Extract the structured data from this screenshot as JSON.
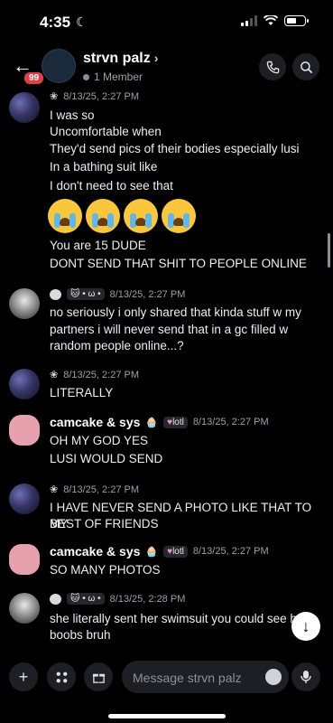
{
  "status_bar": {
    "time": "4:35"
  },
  "header": {
    "back_badge": "99",
    "channel_name": "strvn palz",
    "members": "1 Member"
  },
  "messages": [
    {
      "author": "",
      "timestamp": "8/13/25, 2:27 PM",
      "lines": [
        "I was so",
        "Uncomfortable when",
        "They'd send pics of their bodies especially lusi",
        "In a bathing suit like",
        "I don't need to see that"
      ],
      "emojis": [
        "loudly-crying-face",
        "loudly-crying-face",
        "loudly-crying-face",
        "loudly-crying-face"
      ],
      "after_lines": [
        "You are 15 DUDE",
        "DONT SEND THAT SHIT TO PEOPLE ONLINE"
      ]
    },
    {
      "author": "",
      "tag": "• ω •",
      "timestamp": "8/13/25, 2:27 PM",
      "lines": [
        "no seriously i only shared that kinda stuff w my",
        "partners i will never send that in a gc filled w",
        "random people online...?"
      ]
    },
    {
      "author": "",
      "timestamp": "8/13/25, 2:27 PM",
      "lines": [
        "LITERALLY"
      ]
    },
    {
      "author": "camcake & sys",
      "tag": "lotl",
      "timestamp": "8/13/25, 2:27 PM",
      "lines": [
        "OH MY GOD YES",
        "LUSI WOULD SEND"
      ]
    },
    {
      "author": "",
      "timestamp": "8/13/25, 2:27 PM",
      "lines": [
        "I HAVE NEVER SEND A PHOTO LIKE THAT TO MY",
        "BEST OF FRIENDS"
      ]
    },
    {
      "author": "camcake & sys",
      "tag": "lotl",
      "timestamp": "8/13/25, 2:27 PM",
      "lines": [
        "SO MANY PHOTOS"
      ]
    },
    {
      "author": "",
      "tag": "• ω •",
      "timestamp": "8/13/25, 2:28 PM",
      "lines": [
        "she literally sent her swimsuit you could see he",
        "boobs bruh"
      ]
    }
  ],
  "composer": {
    "placeholder": "Message strvn palz"
  },
  "colors": {
    "background": "#000000",
    "badge": "#e53d48",
    "bar_bg": "#1e1f24"
  }
}
